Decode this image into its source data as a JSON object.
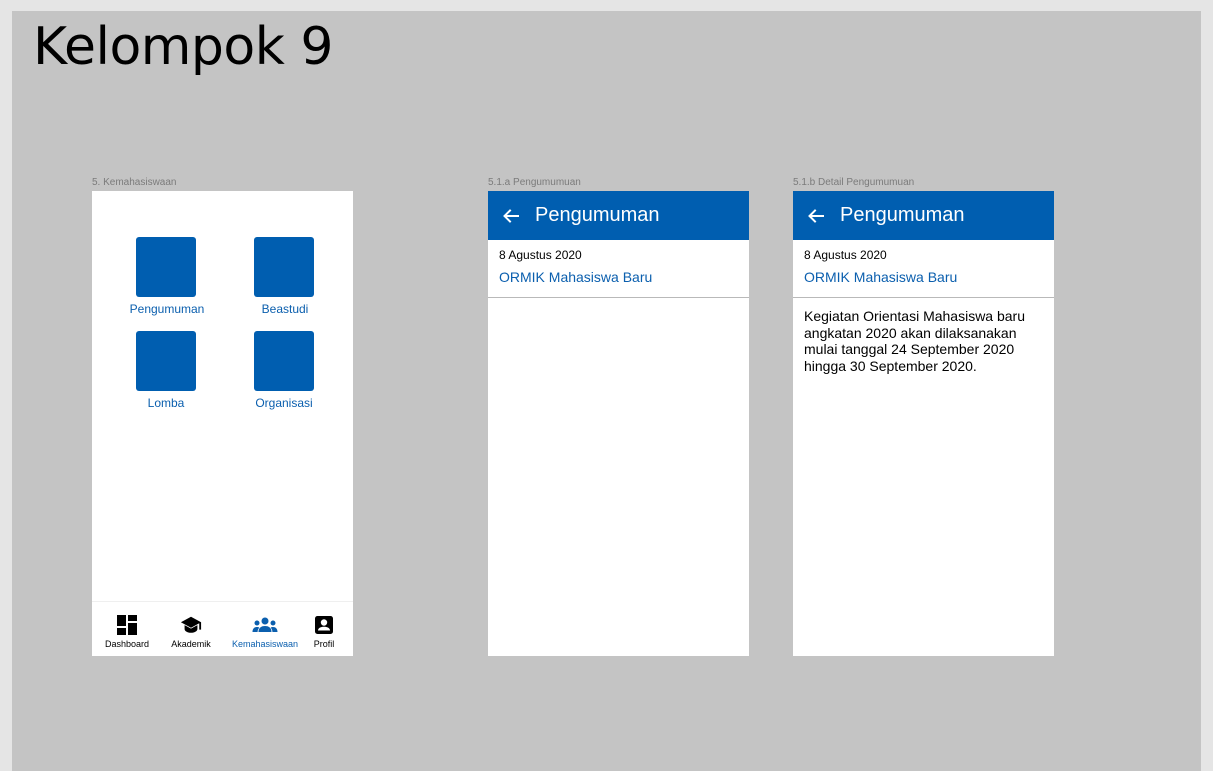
{
  "page": {
    "title": "Kelompok 9"
  },
  "frames": {
    "kemahasiswaan": {
      "label": "5. Kemahasiswaan",
      "tiles": [
        {
          "label": "Pengumuman"
        },
        {
          "label": "Beastudi"
        },
        {
          "label": "Lomba"
        },
        {
          "label": "Organisasi"
        }
      ],
      "nav": [
        {
          "label": "Dashboard",
          "icon": "dashboard-icon"
        },
        {
          "label": "Akademik",
          "icon": "graduation-cap-icon"
        },
        {
          "label": "Kemahasiswaan",
          "icon": "group-icon"
        },
        {
          "label": "Profil",
          "icon": "profile-icon"
        }
      ]
    },
    "pengumuman": {
      "label": "5.1.a Pengumumuan",
      "title": "Pengumuman",
      "item_date": "8 Agustus 2020",
      "item_title": "ORMIK Mahasiswa Baru"
    },
    "detail": {
      "label": "5.1.b Detail Pengumumuan",
      "title": "Pengumuman",
      "item_date": "8 Agustus 2020",
      "item_title": "ORMIK Mahasiswa Baru",
      "body": "Kegiatan  Orientasi Mahasiswa baru\nangkatan 2020 akan dilaksanakan\nmulai tanggal 24 September 2020\nhingga 30 September 2020."
    }
  },
  "colors": {
    "primary": "#005eb0",
    "link": "#0b5fae",
    "canvas": "#c4c4c4"
  }
}
